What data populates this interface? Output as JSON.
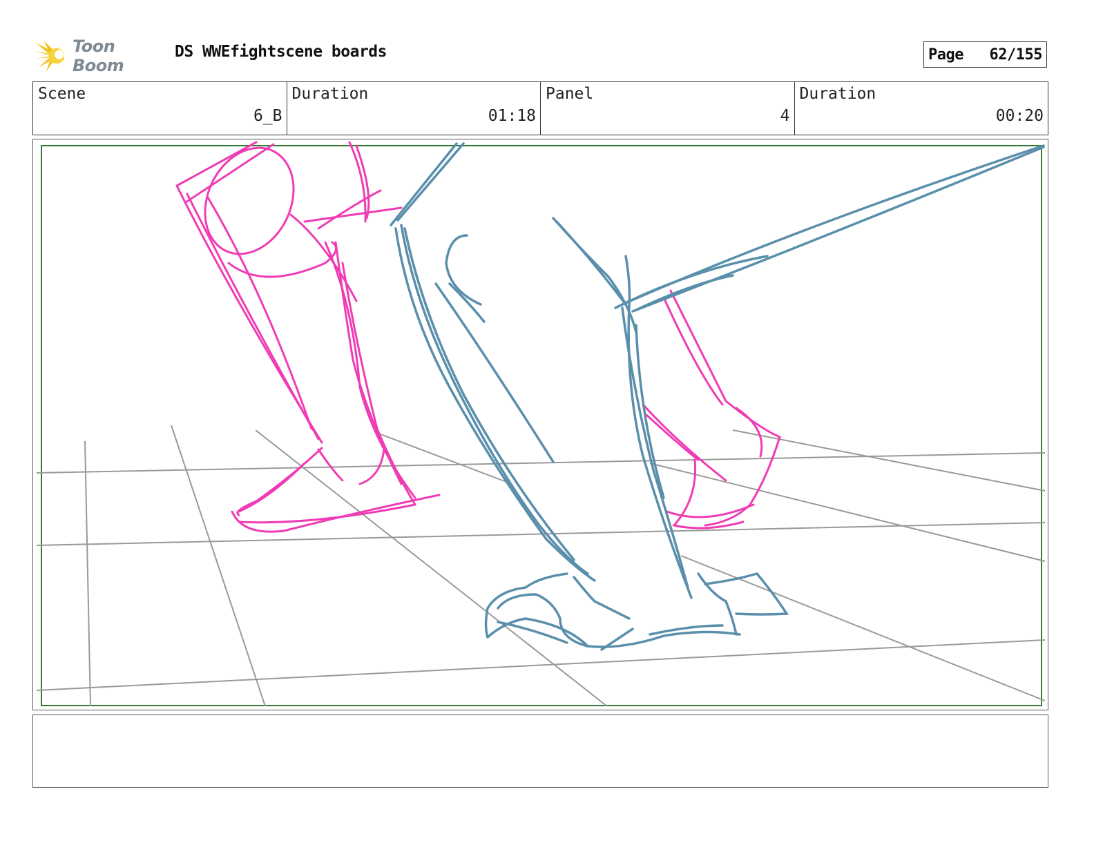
{
  "header": {
    "logo_text": "Toon Boom",
    "doc_title": "DS WWEfightscene boards",
    "page_label": "Page",
    "page_number": "62/155"
  },
  "info": {
    "scene_label": "Scene",
    "scene_value": "6_B",
    "scene_duration_label": "Duration",
    "scene_duration_value": "01:18",
    "panel_label": "Panel",
    "panel_value": "4",
    "panel_duration_label": "Duration",
    "panel_duration_value": "00:20"
  },
  "drawing": {
    "description_icon": "storyboard-sketch",
    "colors": {
      "pink_legs": "#f03cb4",
      "blue_leg": "#5a8fac",
      "floor_grid": "#999999",
      "safe_frame": "#2e7d32"
    }
  },
  "notes": {
    "text": ""
  }
}
